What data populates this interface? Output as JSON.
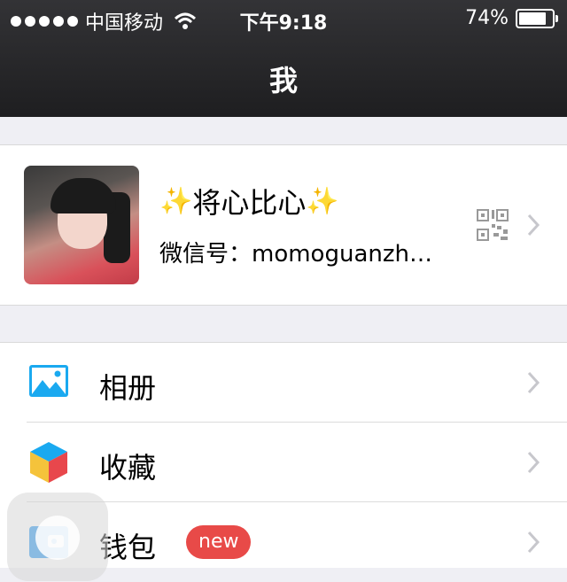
{
  "status_bar": {
    "carrier": "中国移动",
    "time": "下午9:18",
    "battery_percent": "74%",
    "battery_level": 0.74
  },
  "nav": {
    "title": "我"
  },
  "profile": {
    "nickname_sparkle": "✨",
    "nickname": "将心比心",
    "wechat_id": "微信号：momoguanzh…"
  },
  "menu": [
    {
      "label": "相册",
      "icon": "album-icon"
    },
    {
      "label": "收藏",
      "icon": "favorites-icon"
    },
    {
      "label": "钱包",
      "icon": "wallet-icon",
      "badge": "new"
    }
  ],
  "colors": {
    "navbar": "#2a2a2c",
    "badge": "#e84a48",
    "album_icon": "#1aa9f0",
    "wallet_icon": "#2d9af0"
  }
}
